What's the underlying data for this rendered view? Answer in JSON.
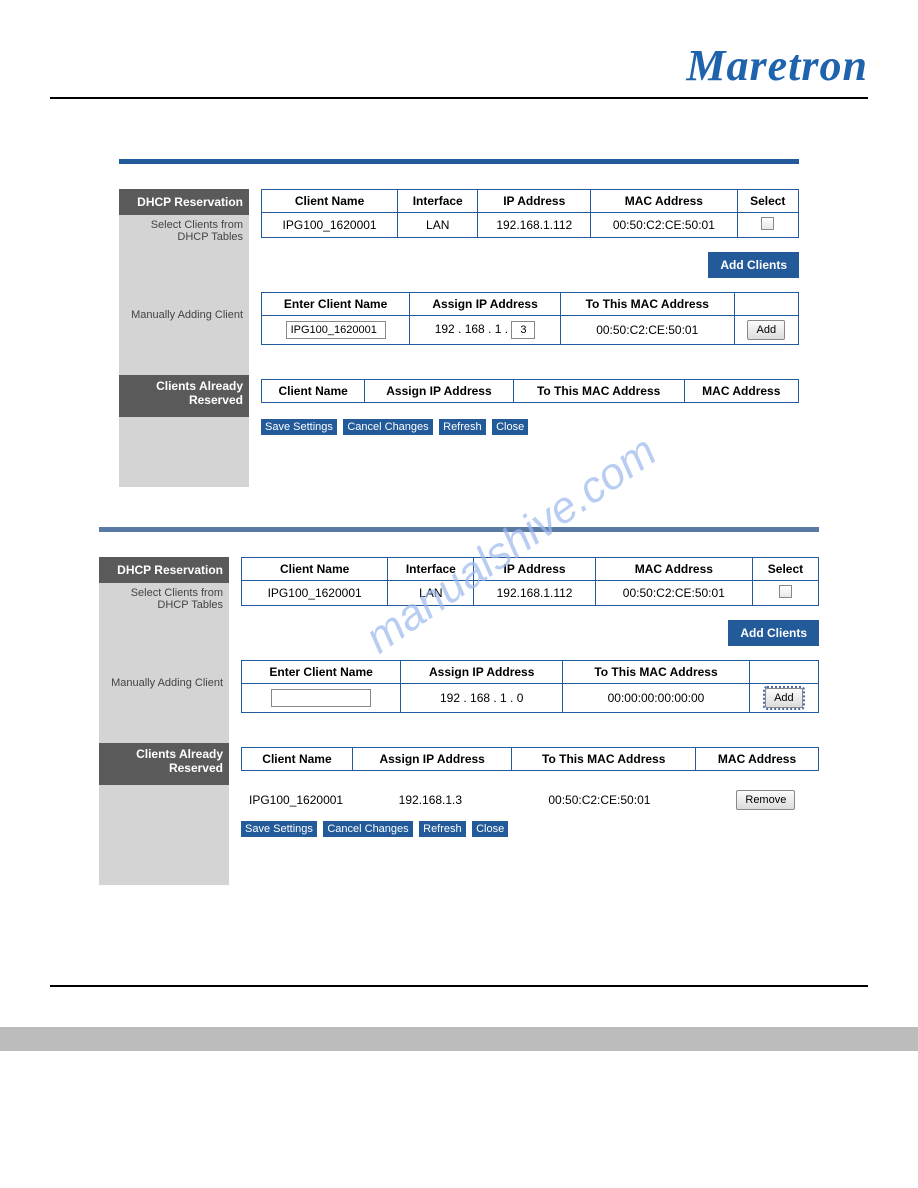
{
  "brand": "Maretron",
  "watermark": "manualshive.com",
  "labels": {
    "dhcp_reservation": "DHCP Reservation",
    "select_clients": "Select Clients from DHCP Tables",
    "manually_adding": "Manually Adding Client",
    "clients_already": "Clients Already Reserved"
  },
  "table1_headers": {
    "client_name": "Client Name",
    "interface": "Interface",
    "ip": "IP Address",
    "mac": "MAC Address",
    "select": "Select"
  },
  "table1_row": {
    "client_name": "IPG100_1620001",
    "interface": "LAN",
    "ip": "192.168.1.112",
    "mac": "00:50:C2:CE:50:01"
  },
  "add_clients": "Add Clients",
  "manual_headers": {
    "enter_name": "Enter Client Name",
    "assign_ip": "Assign IP Address",
    "to_mac": "To This MAC Address"
  },
  "manual_row_a": {
    "name": "IPG100_1620001",
    "ip_prefix": "192 . 168 . 1 .",
    "ip_last": "3",
    "mac": "00:50:C2:CE:50:01"
  },
  "manual_row_b": {
    "name": "",
    "ip_prefix": "192 . 168 . 1 .",
    "ip_last": "0",
    "mac": "00:00:00:00:00:00"
  },
  "add": "Add",
  "reserved_headers": {
    "client_name": "Client Name",
    "assign_ip": "Assign IP Address",
    "to_mac": "To This MAC Address",
    "mac_addr": "MAC Address"
  },
  "reserved_row": {
    "name": "IPG100_1620001",
    "ip": "192.168.1.3",
    "mac": "00:50:C2:CE:50:01"
  },
  "remove": "Remove",
  "actions": {
    "save": "Save Settings",
    "cancel": "Cancel Changes",
    "refresh": "Refresh",
    "close": "Close"
  }
}
